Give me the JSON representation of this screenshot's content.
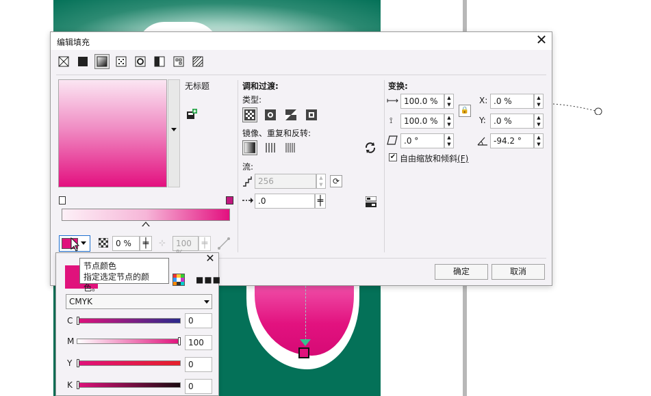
{
  "dialog": {
    "title": "编辑填充",
    "close": "✕",
    "untitled": "无标题",
    "ok": "确定",
    "cancel": "取消"
  },
  "fill_types": [
    "no-fill-icon",
    "uniform-fill-icon",
    "fountain-fill-icon",
    "vector-pattern-icon",
    "bitmap-pattern-icon",
    "two-color-pattern-icon",
    "texture-fill-icon",
    "postscript-fill-icon"
  ],
  "gradient": {
    "start_color": "#fdf0f7",
    "end_color": "#e3107f",
    "node_color": "#e0127c",
    "transparency": "0 %",
    "position": "100 %"
  },
  "blend": {
    "title": "调和过渡:",
    "type_label": "类型:",
    "mirror_label": "镜像、重复和反转:",
    "flow_label": "流:",
    "steps": "256",
    "acceleration": ".0"
  },
  "transform": {
    "title": "变换:",
    "width": "100.0 %",
    "height": "100.0 %",
    "skew": ".0 °",
    "x_label": "X:",
    "x": ".0 %",
    "y_label": "Y:",
    "y": ".0 %",
    "rotation": "-94.2 °",
    "free_scale_label": "自由缩放和倾斜",
    "free_scale_hotkey": "(F)"
  },
  "node_popup": {
    "close": "✕",
    "model": "CMYK",
    "channels": [
      {
        "label": "C",
        "value": "0",
        "level": 0
      },
      {
        "label": "M",
        "value": "100",
        "level": 1
      },
      {
        "label": "Y",
        "value": "0",
        "level": 0
      },
      {
        "label": "K",
        "value": "0",
        "level": 0
      }
    ]
  },
  "tooltip": {
    "title": "节点颜色",
    "description": "指定选定节点的颜色。"
  }
}
